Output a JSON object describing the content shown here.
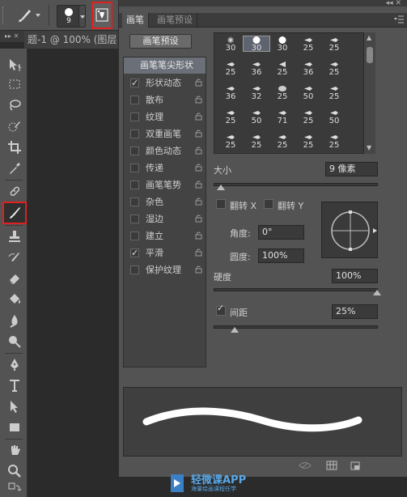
{
  "options_bar": {
    "brush_size": "9"
  },
  "document": {
    "tab_title": "题-1 @ 100% (图层"
  },
  "panel": {
    "tabs": [
      "画笔",
      "画笔预设"
    ],
    "preset_button": "画笔预设",
    "list_header": "画笔笔尖形状",
    "list_items": [
      {
        "label": "形状动态",
        "checked": true
      },
      {
        "label": "散布",
        "checked": false
      },
      {
        "label": "纹理",
        "checked": false
      },
      {
        "label": "双重画笔",
        "checked": false
      },
      {
        "label": "颜色动态",
        "checked": false
      },
      {
        "label": "传递",
        "checked": false
      },
      {
        "label": "画笔笔势",
        "checked": false
      },
      {
        "label": "杂色",
        "checked": false
      },
      {
        "label": "湿边",
        "checked": false
      },
      {
        "label": "建立",
        "checked": false
      },
      {
        "label": "平滑",
        "checked": true
      },
      {
        "label": "保护纹理",
        "checked": false
      }
    ],
    "brush_tips": [
      [
        "30",
        "30",
        "30",
        "25",
        "25"
      ],
      [
        "25",
        "36",
        "25",
        "36",
        "25"
      ],
      [
        "36",
        "32",
        "25",
        "50",
        "25"
      ],
      [
        "25",
        "50",
        "71",
        "25",
        "50"
      ],
      [
        "25",
        "25",
        "25",
        "25",
        "25"
      ]
    ],
    "size_label": "大小",
    "size_value": "9 像素",
    "flip_x_label": "翻转 X",
    "flip_y_label": "翻转 Y",
    "angle_label": "角度:",
    "angle_value": "0°",
    "roundness_label": "圆度:",
    "roundness_value": "100%",
    "hardness_label": "硬度",
    "hardness_value": "100%",
    "spacing_label": "间距",
    "spacing_value": "25%",
    "spacing_checked": true
  },
  "watermark": {
    "title": "轻微课APP",
    "subtitle": "海量绘画课程任学"
  },
  "colors": {
    "highlight_red": "#e02020",
    "accent_blue": "#5aa7e6"
  }
}
